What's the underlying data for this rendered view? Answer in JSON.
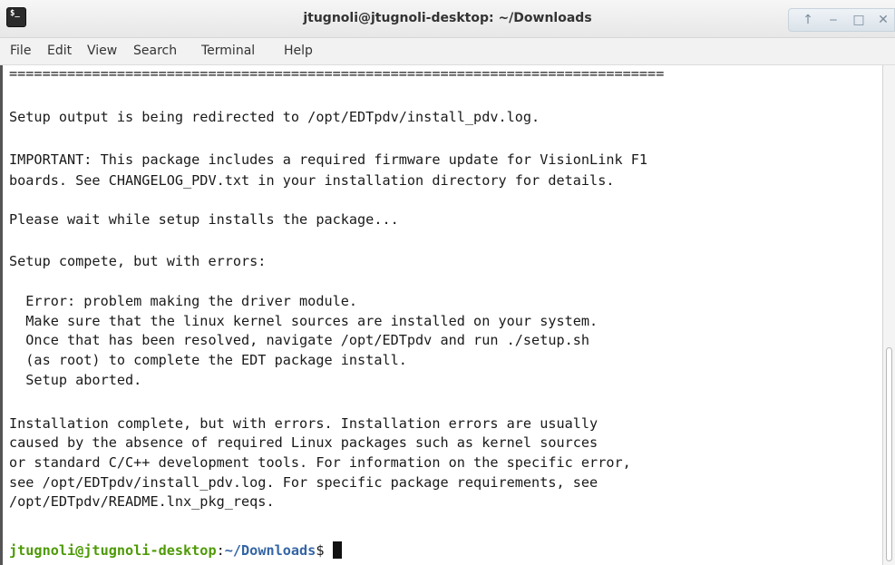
{
  "window": {
    "title": "jtugnoli@jtugnoli-desktop: ~/Downloads",
    "app_icon_text": "$_",
    "controls": {
      "up": "↑",
      "minimize": "‒",
      "maximize": "□",
      "close": "✕"
    }
  },
  "menubar": {
    "items": [
      "File",
      "Edit",
      "View",
      "Search",
      "Terminal",
      "Help"
    ]
  },
  "terminal": {
    "lines": [
      "===============================================================================",
      "",
      "Setup output is being redirected to /opt/EDTpdv/install_pdv.log.",
      "",
      "IMPORTANT: This package includes a required firmware update for VisionLink F1",
      "boards. See CHANGELOG_PDV.txt in your installation directory for details.",
      "",
      "Please wait while setup installs the package...",
      "",
      "Setup compete, but with errors:",
      "",
      "  Error: problem making the driver module.",
      "  Make sure that the linux kernel sources are installed on your system.",
      "  Once that has been resolved, navigate /opt/EDTpdv and run ./setup.sh",
      "  (as root) to complete the EDT package install.",
      "  Setup aborted.",
      "",
      "Installation complete, but with errors. Installation errors are usually",
      "caused by the absence of required Linux packages such as kernel sources",
      "or standard C/C++ development tools. For information on the specific error,",
      "see /opt/EDTpdv/install_pdv.log. For specific package requirements, see",
      "/opt/EDTpdv/README.lnx_pkg_reqs.",
      ""
    ],
    "prompt": {
      "user_host": "jtugnoli@jtugnoli-desktop",
      "separator": ":",
      "path": "~/Downloads",
      "symbol": "$ "
    }
  }
}
